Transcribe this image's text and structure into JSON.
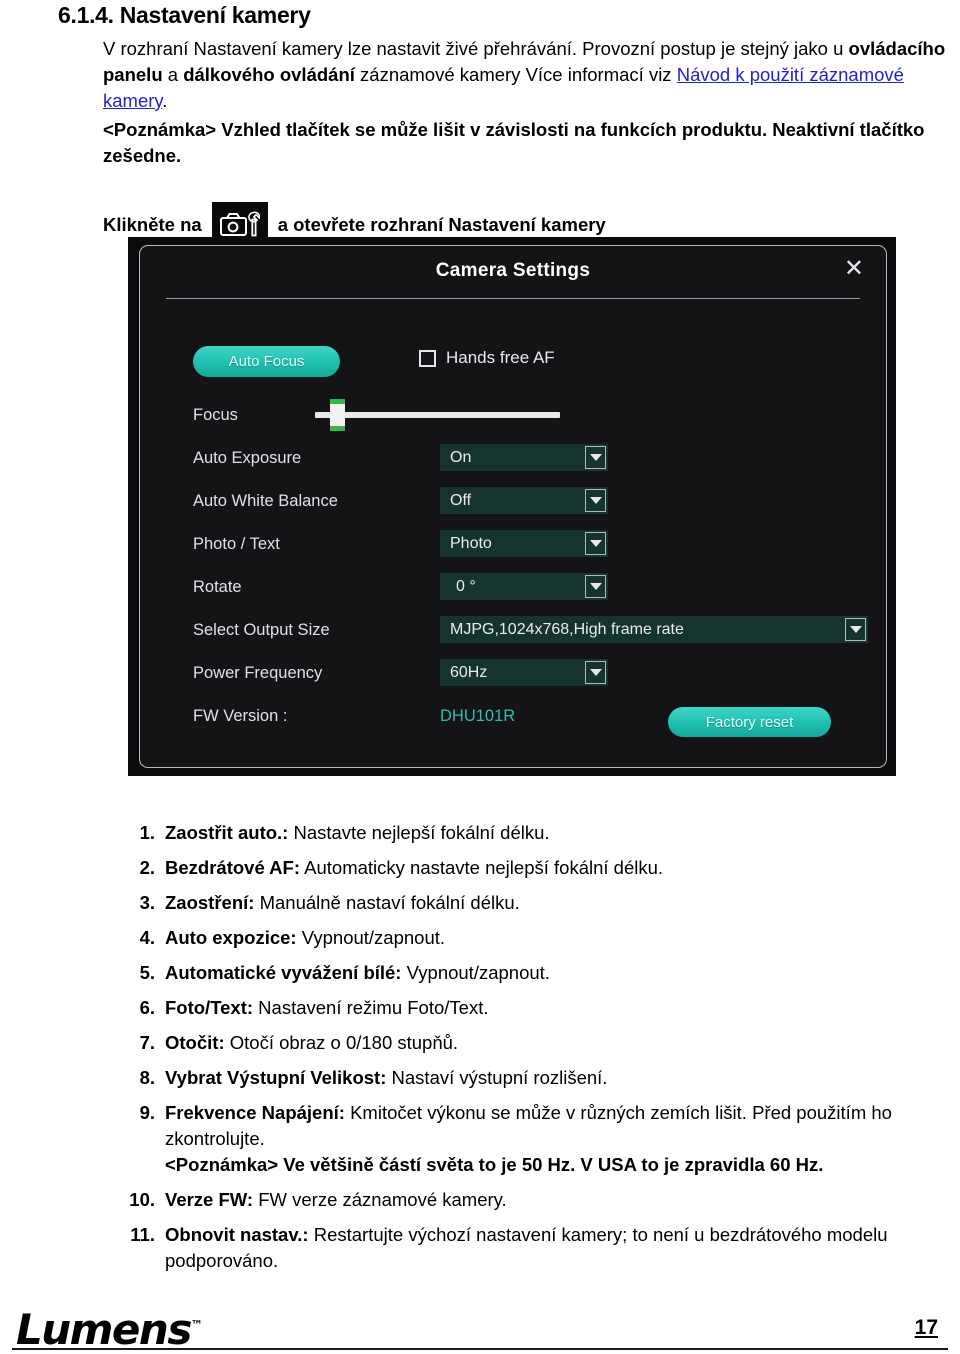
{
  "heading": {
    "number": "6.1.4.",
    "title": "Nastavení kamery"
  },
  "intro": {
    "part1": "V rozhraní Nastavení kamery lze nastavit živé přehrávání. Provozní postup je stejný jako u ",
    "bold1": "ovládacího panelu",
    "mid1": " a ",
    "bold2": "dálkového ovládání",
    "mid2": " záznamové kamery Více informací viz ",
    "link": "Návod k použití záznamové kamery",
    "end": "."
  },
  "note": "<Poznámka> Vzhled tlačítek se může lišit v závislosti na funkcích produktu. Neaktivní tlačítko zešedne.",
  "click_line": {
    "before": "Klikněte na",
    "after": "a otevřete rozhraní Nastavení kamery",
    "icon": "camera-settings-icon"
  },
  "dialog": {
    "title": "Camera Settings",
    "close_label": "✕",
    "auto_focus_button": "Auto Focus",
    "hands_free_af_label": "Hands free AF",
    "hands_free_af_checked": false,
    "focus_label": "Focus",
    "focus_value": 6,
    "rows": [
      {
        "label": "Auto Exposure",
        "value": "On"
      },
      {
        "label": "Auto White Balance",
        "value": "Off"
      },
      {
        "label": "Photo / Text",
        "value": "Photo"
      },
      {
        "label": "Rotate",
        "value": "0 °"
      },
      {
        "label": "Select Output Size",
        "value": "MJPG,1024x768,High frame rate"
      },
      {
        "label": "Power Frequency",
        "value": "60Hz"
      }
    ],
    "fw_label": "FW Version :",
    "fw_value": "DHU101R",
    "factory_reset_button": "Factory reset",
    "colors": {
      "panel_bg": "#141417",
      "frame_bg": "#0b0b0d",
      "accent_teal": "#1ebfb0",
      "field_teal": "#16342f",
      "fw_text": "#2fbfae",
      "slider_green": "#35b64a"
    }
  },
  "list": [
    {
      "num": "1.",
      "bold": "Zaostřit auto.:",
      "rest": " Nastavte nejlepší fokální délku."
    },
    {
      "num": "2.",
      "bold": "Bezdrátové AF:",
      "rest": " Automaticky nastavte nejlepší fokální délku."
    },
    {
      "num": "3.",
      "bold": "Zaostření:",
      "rest": " Manuálně nastaví fokální délku."
    },
    {
      "num": "4.",
      "bold": "Auto expozice:",
      "rest": " Vypnout/zapnout."
    },
    {
      "num": "5.",
      "bold": "Automatické vyvážení bílé:",
      "rest": " Vypnout/zapnout."
    },
    {
      "num": "6.",
      "bold": "Foto/Text:",
      "rest": " Nastavení režimu Foto/Text."
    },
    {
      "num": "7.",
      "bold": "Otočit:",
      "rest": " Otočí obraz o 0/180 stupňů."
    },
    {
      "num": "8.",
      "bold": "Vybrat Výstupní Velikost:",
      "rest": " Nastaví výstupní rozlišení."
    },
    {
      "num": "9.",
      "bold": "Frekvence Napájení:",
      "rest": " Kmitočet výkonu se může v různých zemích lišit. Před použitím ho zkontrolujte.",
      "note": "<Poznámka> Ve většině částí světa to je 50 Hz. V USA to je zpravidla 60 Hz."
    },
    {
      "num": "10.",
      "bold": "Verze FW:",
      "rest": " FW verze záznamové kamery."
    },
    {
      "num": "11.",
      "bold": "Obnovit nastav.:",
      "rest": " Restartujte výchozí nastavení kamery; to není u bezdrátového modelu podporováno."
    }
  ],
  "footer": {
    "logo": "Lumens",
    "trademark": "™",
    "page_number": "17"
  }
}
